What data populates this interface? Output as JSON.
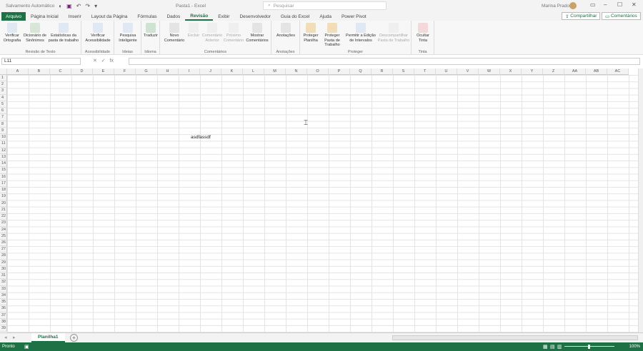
{
  "titlebar": {
    "autosave": "Salvamento Automático",
    "doc_title": "Pasta1 - Excel",
    "search_placeholder": "Pesquisar",
    "user": "Marina Prado"
  },
  "tabs": [
    "Arquivo",
    "Página Inicial",
    "Inserir",
    "Layout da Página",
    "Fórmulas",
    "Dados",
    "Revisão",
    "Exibir",
    "Desenvolvedor",
    "Guia do Excel",
    "Ajuda",
    "Power Pivot"
  ],
  "active_tab": "Revisão",
  "share": {
    "share_label": "Compartilhar",
    "comments_label": "Comentários"
  },
  "ribbon": {
    "groups": [
      {
        "label": "Revisão de Texto",
        "buttons": [
          "Verificar Ortografia",
          "Dicionário de Sinônimos",
          "Estatísticas da pasta de trabalho"
        ]
      },
      {
        "label": "Acessibilidade",
        "buttons": [
          "Verificar Acessibilidade"
        ]
      },
      {
        "label": "Ideias",
        "buttons": [
          "Pesquisa Inteligente"
        ]
      },
      {
        "label": "Idioma",
        "buttons": [
          "Traduzir"
        ]
      },
      {
        "label": "Comentários",
        "buttons": [
          "Novo Comentário",
          "Excluir",
          "Comentário Anterior",
          "Próximo Comentário",
          "Mostrar Comentários"
        ]
      },
      {
        "label": "Anotações",
        "buttons": [
          "Anotações"
        ]
      },
      {
        "label": "Proteger",
        "buttons": [
          "Proteger Planilha",
          "Proteger Pasta de Trabalho",
          "Permitir a Edição de Intervalos",
          "Descompartilhar Pasta de Trabalho"
        ]
      },
      {
        "label": "Tinta",
        "buttons": [
          "Ocultar Tinta"
        ]
      }
    ]
  },
  "formula_bar": {
    "name_box": "L11",
    "fx": "fx"
  },
  "columns": [
    "A",
    "B",
    "C",
    "D",
    "E",
    "F",
    "G",
    "H",
    "I",
    "J",
    "K",
    "L",
    "M",
    "N",
    "O",
    "P",
    "Q",
    "R",
    "S",
    "T",
    "U",
    "V",
    "W",
    "X",
    "Y",
    "Z",
    "AA",
    "AB",
    "AC"
  ],
  "rows": [
    "1",
    "2",
    "3",
    "4",
    "5",
    "6",
    "7",
    "8",
    "9",
    "10",
    "11",
    "12",
    "13",
    "14",
    "15",
    "16",
    "17",
    "18",
    "19",
    "20",
    "21",
    "22",
    "23",
    "24",
    "25",
    "26",
    "27",
    "28",
    "29",
    "30",
    "31",
    "32",
    "33",
    "34",
    "35",
    "36",
    "37",
    "38",
    "39"
  ],
  "cells": {
    "J10": "asdfassdf"
  },
  "sheets": [
    "Planilha1"
  ],
  "status": {
    "ready": "Pronto",
    "zoom": "100%"
  },
  "colors": {
    "accent": "#1e7145"
  }
}
